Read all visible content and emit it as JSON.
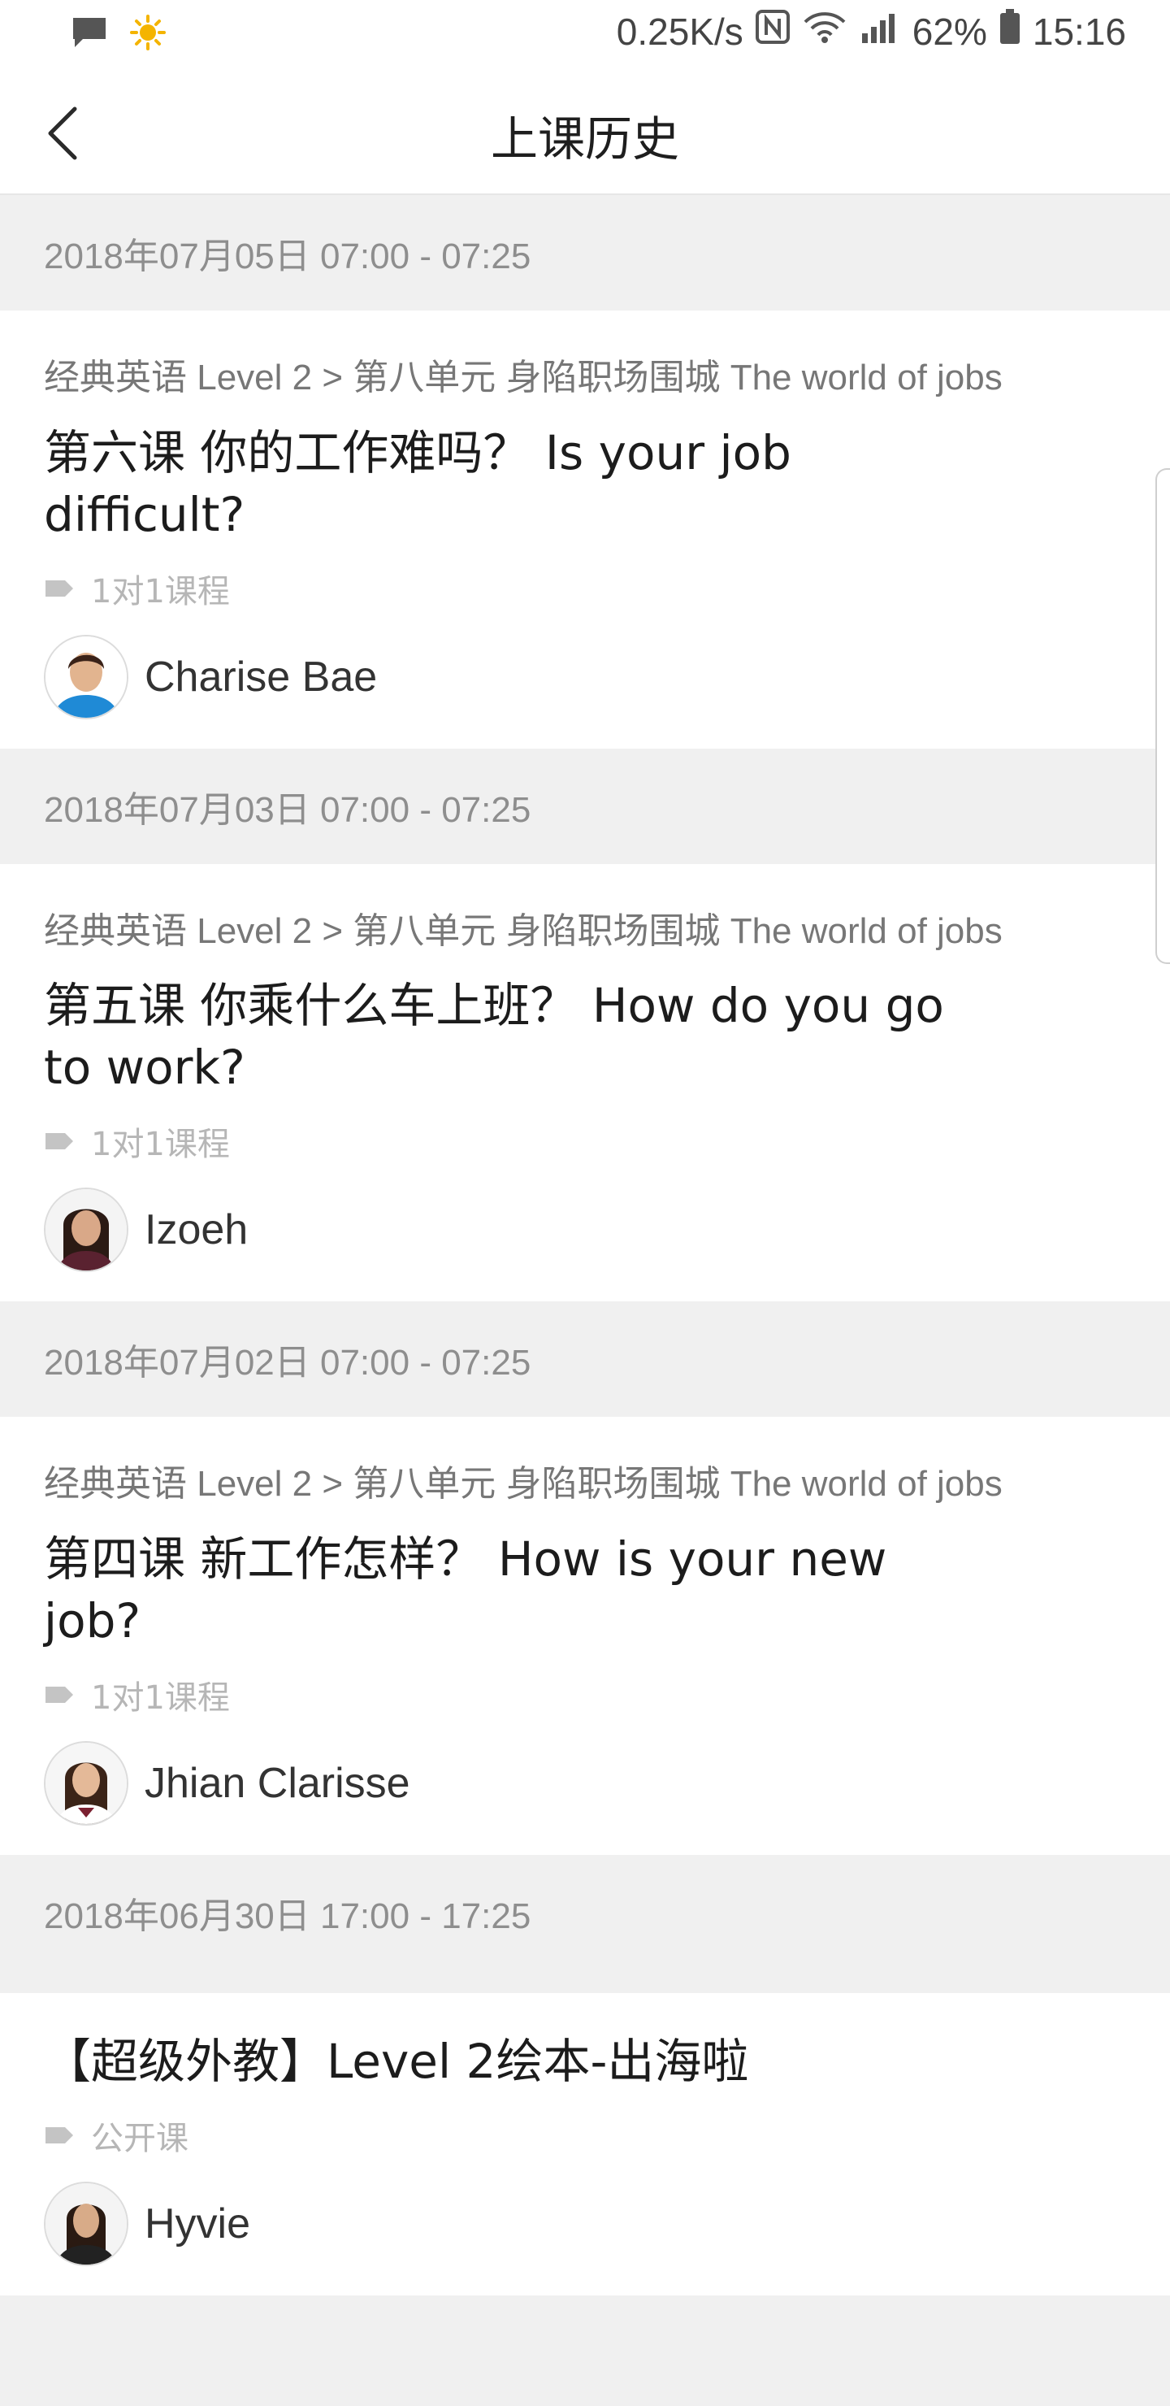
{
  "status_bar": {
    "network_speed": "0.25K/s",
    "battery": "62%",
    "time": "15:16",
    "icons": [
      "message-icon",
      "sun-icon",
      "nfc-icon",
      "wifi-icon",
      "signal-icon",
      "battery-icon"
    ]
  },
  "header": {
    "title": "上课历史",
    "back_icon": "chevron-left-icon"
  },
  "lessons": [
    {
      "date": "2018年07月05日 07:00 - 07:25",
      "path": "经典英语 Level 2 > 第八单元 身陷职场围城 The world of jobs",
      "title": "第六课 你的工作难吗？ Is your job difficult?",
      "tag": "1对1课程",
      "teacher": "Charise Bae"
    },
    {
      "date": "2018年07月03日 07:00 - 07:25",
      "path": "经典英语 Level 2 > 第八单元 身陷职场围城 The world of jobs",
      "title": "第五课 你乘什么车上班？ How do you go to work?",
      "tag": "1对1课程",
      "teacher": "Izoeh"
    },
    {
      "date": "2018年07月02日 07:00 - 07:25",
      "path": "经典英语 Level 2 > 第八单元 身陷职场围城 The world of jobs",
      "title": "第四课 新工作怎样？ How is your new job?",
      "tag": "1对1课程",
      "teacher": "Jhian Clarisse"
    },
    {
      "date": "2018年06月30日 17:00 - 17:25",
      "path": "",
      "title": "【超级外教】Level 2绘本-出海啦",
      "tag": "公开课",
      "teacher": "Hyvie"
    }
  ]
}
